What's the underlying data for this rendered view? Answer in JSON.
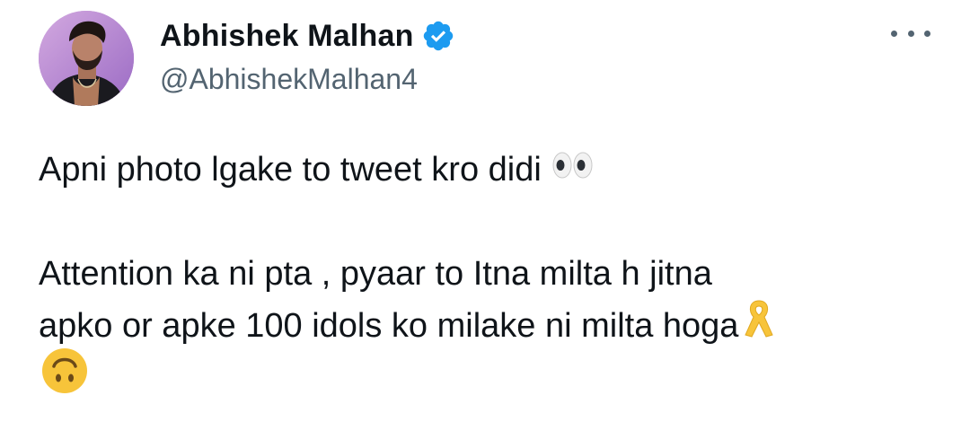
{
  "author": {
    "display_name": "Abhishek Malhan",
    "handle": "@AbhishekMalhan4",
    "verified": true,
    "verified_color": "#1d9bf0"
  },
  "tweet": {
    "line1": "Apni photo lgake to tweet kro didi",
    "line1_emoji": "eyes-emoji",
    "line2": "Attention ka ni pta , pyaar to Itna milta h jitna",
    "line3": "apko or apke 100 idols ko milake ni milta hoga",
    "line3_emoji": "yellow-ribbon-emoji",
    "line4_emoji": "upside-down-face-emoji"
  },
  "icons": {
    "more": "more-options-icon",
    "verified": "verified-badge-icon"
  },
  "colors": {
    "text_primary": "#0f1419",
    "text_secondary": "#536471",
    "emoji_yellow": "#f7c43a"
  }
}
